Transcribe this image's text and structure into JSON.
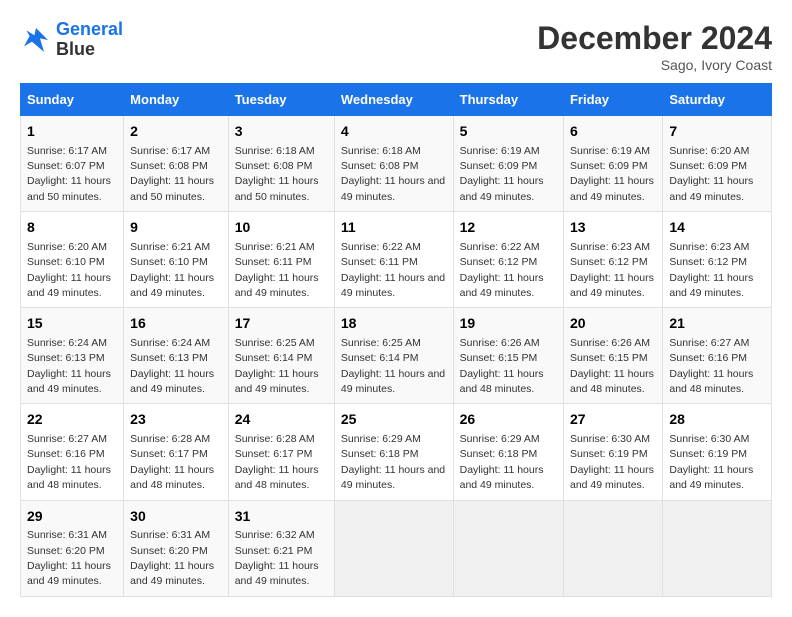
{
  "header": {
    "logo_line1": "General",
    "logo_line2": "Blue",
    "month": "December 2024",
    "location": "Sago, Ivory Coast"
  },
  "days_of_week": [
    "Sunday",
    "Monday",
    "Tuesday",
    "Wednesday",
    "Thursday",
    "Friday",
    "Saturday"
  ],
  "weeks": [
    [
      {
        "day": "1",
        "sunrise": "6:17 AM",
        "sunset": "6:07 PM",
        "daylight": "11 hours and 50 minutes."
      },
      {
        "day": "2",
        "sunrise": "6:17 AM",
        "sunset": "6:08 PM",
        "daylight": "11 hours and 50 minutes."
      },
      {
        "day": "3",
        "sunrise": "6:18 AM",
        "sunset": "6:08 PM",
        "daylight": "11 hours and 50 minutes."
      },
      {
        "day": "4",
        "sunrise": "6:18 AM",
        "sunset": "6:08 PM",
        "daylight": "11 hours and 49 minutes."
      },
      {
        "day": "5",
        "sunrise": "6:19 AM",
        "sunset": "6:09 PM",
        "daylight": "11 hours and 49 minutes."
      },
      {
        "day": "6",
        "sunrise": "6:19 AM",
        "sunset": "6:09 PM",
        "daylight": "11 hours and 49 minutes."
      },
      {
        "day": "7",
        "sunrise": "6:20 AM",
        "sunset": "6:09 PM",
        "daylight": "11 hours and 49 minutes."
      }
    ],
    [
      {
        "day": "8",
        "sunrise": "6:20 AM",
        "sunset": "6:10 PM",
        "daylight": "11 hours and 49 minutes."
      },
      {
        "day": "9",
        "sunrise": "6:21 AM",
        "sunset": "6:10 PM",
        "daylight": "11 hours and 49 minutes."
      },
      {
        "day": "10",
        "sunrise": "6:21 AM",
        "sunset": "6:11 PM",
        "daylight": "11 hours and 49 minutes."
      },
      {
        "day": "11",
        "sunrise": "6:22 AM",
        "sunset": "6:11 PM",
        "daylight": "11 hours and 49 minutes."
      },
      {
        "day": "12",
        "sunrise": "6:22 AM",
        "sunset": "6:12 PM",
        "daylight": "11 hours and 49 minutes."
      },
      {
        "day": "13",
        "sunrise": "6:23 AM",
        "sunset": "6:12 PM",
        "daylight": "11 hours and 49 minutes."
      },
      {
        "day": "14",
        "sunrise": "6:23 AM",
        "sunset": "6:12 PM",
        "daylight": "11 hours and 49 minutes."
      }
    ],
    [
      {
        "day": "15",
        "sunrise": "6:24 AM",
        "sunset": "6:13 PM",
        "daylight": "11 hours and 49 minutes."
      },
      {
        "day": "16",
        "sunrise": "6:24 AM",
        "sunset": "6:13 PM",
        "daylight": "11 hours and 49 minutes."
      },
      {
        "day": "17",
        "sunrise": "6:25 AM",
        "sunset": "6:14 PM",
        "daylight": "11 hours and 49 minutes."
      },
      {
        "day": "18",
        "sunrise": "6:25 AM",
        "sunset": "6:14 PM",
        "daylight": "11 hours and 49 minutes."
      },
      {
        "day": "19",
        "sunrise": "6:26 AM",
        "sunset": "6:15 PM",
        "daylight": "11 hours and 48 minutes."
      },
      {
        "day": "20",
        "sunrise": "6:26 AM",
        "sunset": "6:15 PM",
        "daylight": "11 hours and 48 minutes."
      },
      {
        "day": "21",
        "sunrise": "6:27 AM",
        "sunset": "6:16 PM",
        "daylight": "11 hours and 48 minutes."
      }
    ],
    [
      {
        "day": "22",
        "sunrise": "6:27 AM",
        "sunset": "6:16 PM",
        "daylight": "11 hours and 48 minutes."
      },
      {
        "day": "23",
        "sunrise": "6:28 AM",
        "sunset": "6:17 PM",
        "daylight": "11 hours and 48 minutes."
      },
      {
        "day": "24",
        "sunrise": "6:28 AM",
        "sunset": "6:17 PM",
        "daylight": "11 hours and 48 minutes."
      },
      {
        "day": "25",
        "sunrise": "6:29 AM",
        "sunset": "6:18 PM",
        "daylight": "11 hours and 49 minutes."
      },
      {
        "day": "26",
        "sunrise": "6:29 AM",
        "sunset": "6:18 PM",
        "daylight": "11 hours and 49 minutes."
      },
      {
        "day": "27",
        "sunrise": "6:30 AM",
        "sunset": "6:19 PM",
        "daylight": "11 hours and 49 minutes."
      },
      {
        "day": "28",
        "sunrise": "6:30 AM",
        "sunset": "6:19 PM",
        "daylight": "11 hours and 49 minutes."
      }
    ],
    [
      {
        "day": "29",
        "sunrise": "6:31 AM",
        "sunset": "6:20 PM",
        "daylight": "11 hours and 49 minutes."
      },
      {
        "day": "30",
        "sunrise": "6:31 AM",
        "sunset": "6:20 PM",
        "daylight": "11 hours and 49 minutes."
      },
      {
        "day": "31",
        "sunrise": "6:32 AM",
        "sunset": "6:21 PM",
        "daylight": "11 hours and 49 minutes."
      },
      null,
      null,
      null,
      null
    ]
  ]
}
